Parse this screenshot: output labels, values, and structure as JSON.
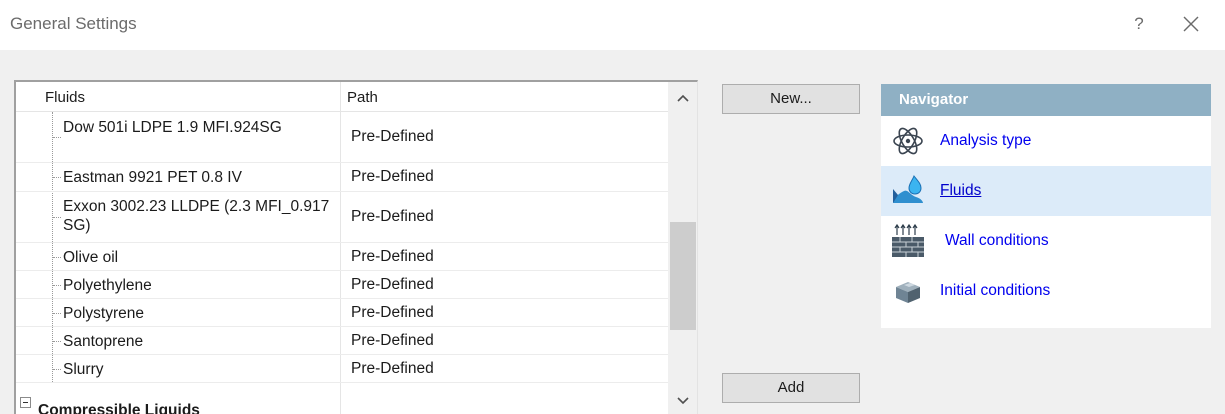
{
  "window": {
    "title": "General Settings",
    "help_glyph": "?",
    "close_icon": "close-icon"
  },
  "tree": {
    "columns": [
      "Fluids",
      "Path"
    ],
    "rows": [
      {
        "name": "Dow 501i LDPE 1.9 MFI.924SG",
        "path": "Pre-Defined"
      },
      {
        "name": "Eastman 9921 PET 0.8 IV",
        "path": "Pre-Defined"
      },
      {
        "name": "Exxon 3002.23 LLDPE (2.3 MFI_0.917 SG)",
        "path": "Pre-Defined"
      },
      {
        "name": "Olive oil",
        "path": "Pre-Defined"
      },
      {
        "name": "Polyethylene",
        "path": "Pre-Defined"
      },
      {
        "name": "Polystyrene",
        "path": "Pre-Defined"
      },
      {
        "name": "Santoprene",
        "path": "Pre-Defined"
      },
      {
        "name": "Slurry",
        "path": "Pre-Defined"
      }
    ],
    "group": {
      "label": "Compressible Liquids",
      "expanded": true
    }
  },
  "buttons": {
    "new_label": "New...",
    "add_label": "Add"
  },
  "navigator": {
    "title": "Navigator",
    "items": [
      {
        "label": "Analysis type",
        "icon": "atom-icon",
        "selected": false
      },
      {
        "label": "Fluids",
        "icon": "fluid-drop-icon",
        "selected": true
      },
      {
        "label": "Wall conditions",
        "icon": "brick-wall-icon",
        "selected": false
      },
      {
        "label": "Initial conditions",
        "icon": "cube-icon",
        "selected": false
      }
    ]
  },
  "colors": {
    "navigator_header": "#8fb0c4",
    "link_blue": "#0000ee",
    "selected_row": "#dcebf9",
    "dialog_bg": "#f0f0f0"
  }
}
